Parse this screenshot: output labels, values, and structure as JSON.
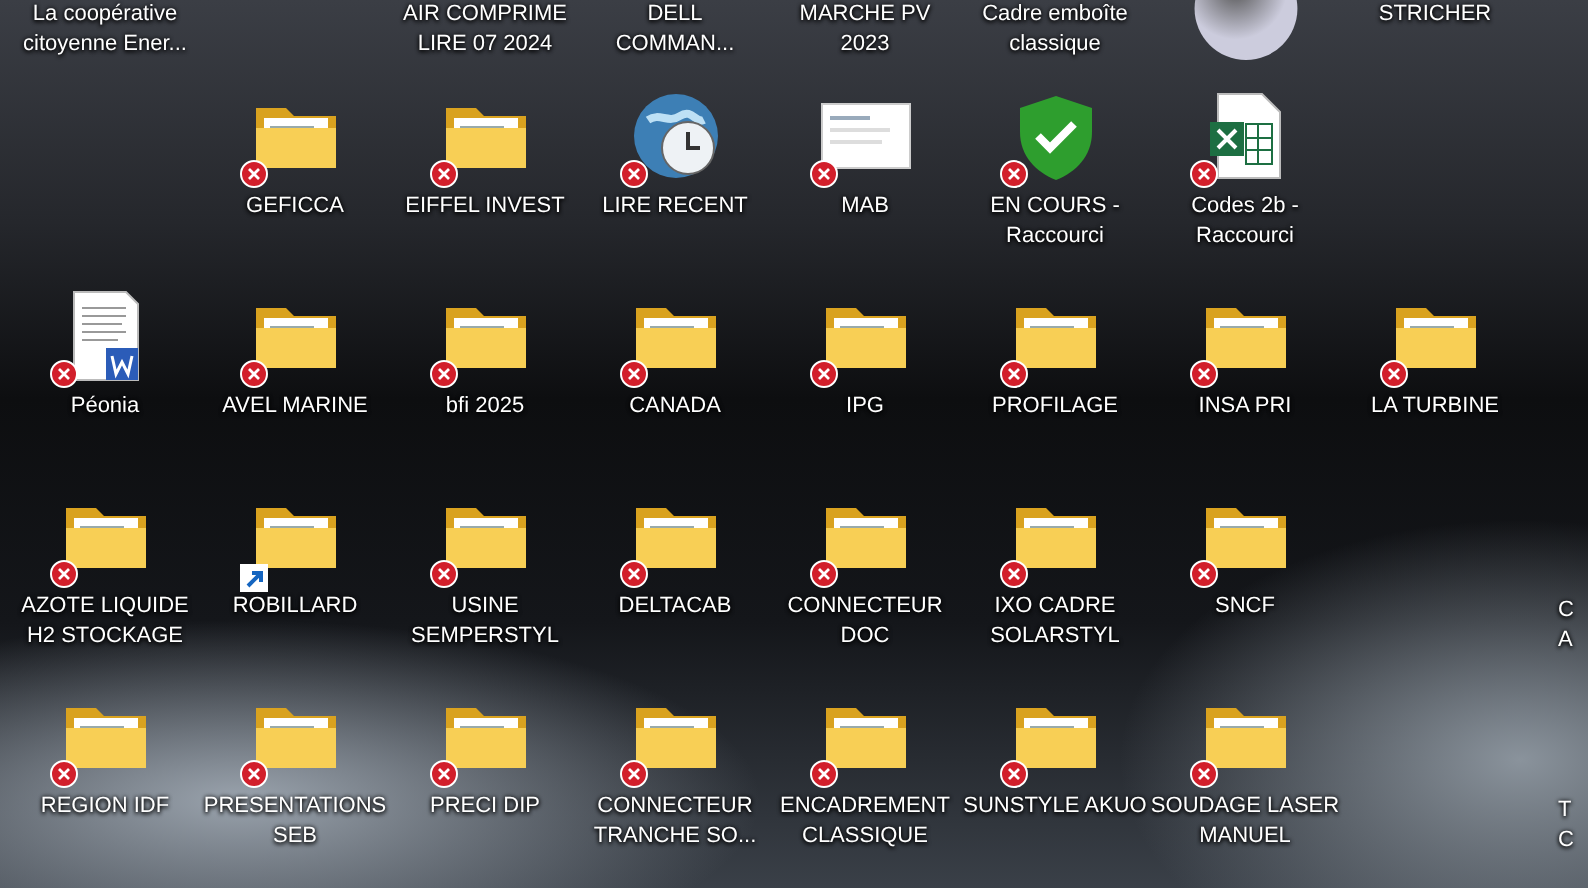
{
  "desktop": {
    "rows": [
      {
        "icons": [
          {
            "kind": "none",
            "label": "La coopérative\ncitoyenne Ener..."
          },
          {
            "kind": "none",
            "label": "AIR COMPRIME\nLIRE 07 2024"
          },
          {
            "kind": "none",
            "label": "DELL\nCOMMAN..."
          },
          {
            "kind": "none",
            "label": "MARCHE PV\n2023"
          },
          {
            "kind": "none",
            "label": "Cadre emboîte\nclassique"
          },
          {
            "kind": "orb"
          },
          {
            "kind": "none",
            "label": "STRICHER"
          }
        ]
      },
      {
        "icons": [
          {
            "kind": "folder",
            "label": "GEFICCA",
            "error": true,
            "shortcut": false
          },
          {
            "kind": "folder",
            "label": "EIFFEL INVEST",
            "error": true,
            "shortcut": false
          },
          {
            "kind": "globe-clock",
            "label": "LIRE RECENT",
            "error": true,
            "shortcut": false
          },
          {
            "kind": "image",
            "label": "MAB",
            "error": true,
            "shortcut": false
          },
          {
            "kind": "shield",
            "label": "EN COURS -\nRaccourci",
            "error": true,
            "shortcut": false
          },
          {
            "kind": "excel",
            "label": "Codes 2b -\nRaccourci",
            "error": true,
            "shortcut": false
          }
        ]
      },
      {
        "icons": [
          {
            "kind": "word",
            "label": "Péonia",
            "error": true,
            "shortcut": false
          },
          {
            "kind": "folder",
            "label": "AVEL MARINE",
            "error": true,
            "shortcut": false
          },
          {
            "kind": "folder",
            "label": "bfi 2025",
            "error": true,
            "shortcut": false
          },
          {
            "kind": "folder",
            "label": "CANADA",
            "error": true,
            "shortcut": false
          },
          {
            "kind": "folder",
            "label": "IPG",
            "error": true,
            "shortcut": false
          },
          {
            "kind": "folder",
            "label": "PROFILAGE",
            "error": true,
            "shortcut": false
          },
          {
            "kind": "folder",
            "label": "INSA PRI",
            "error": true,
            "shortcut": false
          },
          {
            "kind": "folder",
            "label": "LA TURBINE",
            "error": true,
            "shortcut": false
          }
        ]
      },
      {
        "icons": [
          {
            "kind": "folder",
            "label": "AZOTE LIQUIDE\nH2 STOCKAGE",
            "error": true,
            "shortcut": false
          },
          {
            "kind": "folder",
            "label": "ROBILLARD",
            "error": false,
            "shortcut": true
          },
          {
            "kind": "folder",
            "label": "USINE\nSEMPERSTYL",
            "error": true,
            "shortcut": false
          },
          {
            "kind": "folder",
            "label": "DELTACAB",
            "error": true,
            "shortcut": false
          },
          {
            "kind": "folder",
            "label": "CONNECTEUR\nDOC",
            "error": true,
            "shortcut": false
          },
          {
            "kind": "folder",
            "label": "IXO CADRE\nSOLARSTYL",
            "error": true,
            "shortcut": false
          },
          {
            "kind": "folder",
            "label": "SNCF",
            "error": true,
            "shortcut": false
          },
          {
            "kind": "partial",
            "label": "C\nA"
          }
        ]
      },
      {
        "icons": [
          {
            "kind": "folder",
            "label": "REGION IDF",
            "error": true,
            "shortcut": false
          },
          {
            "kind": "folder",
            "label": "PRESENTATIONS\nSEB",
            "error": true,
            "shortcut": false
          },
          {
            "kind": "folder",
            "label": "PRECI DIP",
            "error": true,
            "shortcut": false
          },
          {
            "kind": "folder",
            "label": "CONNECTEUR\nTRANCHE SO...",
            "error": true,
            "shortcut": false
          },
          {
            "kind": "folder",
            "label": "ENCADREMENT\nCLASSIQUE",
            "error": true,
            "shortcut": false
          },
          {
            "kind": "folder",
            "label": "SUNSTYLE AKUO",
            "error": true,
            "shortcut": false
          },
          {
            "kind": "folder",
            "label": "SOUDAGE LASER\nMANUEL",
            "error": true,
            "shortcut": false
          },
          {
            "kind": "partial",
            "label": "T\nC"
          }
        ]
      }
    ]
  }
}
